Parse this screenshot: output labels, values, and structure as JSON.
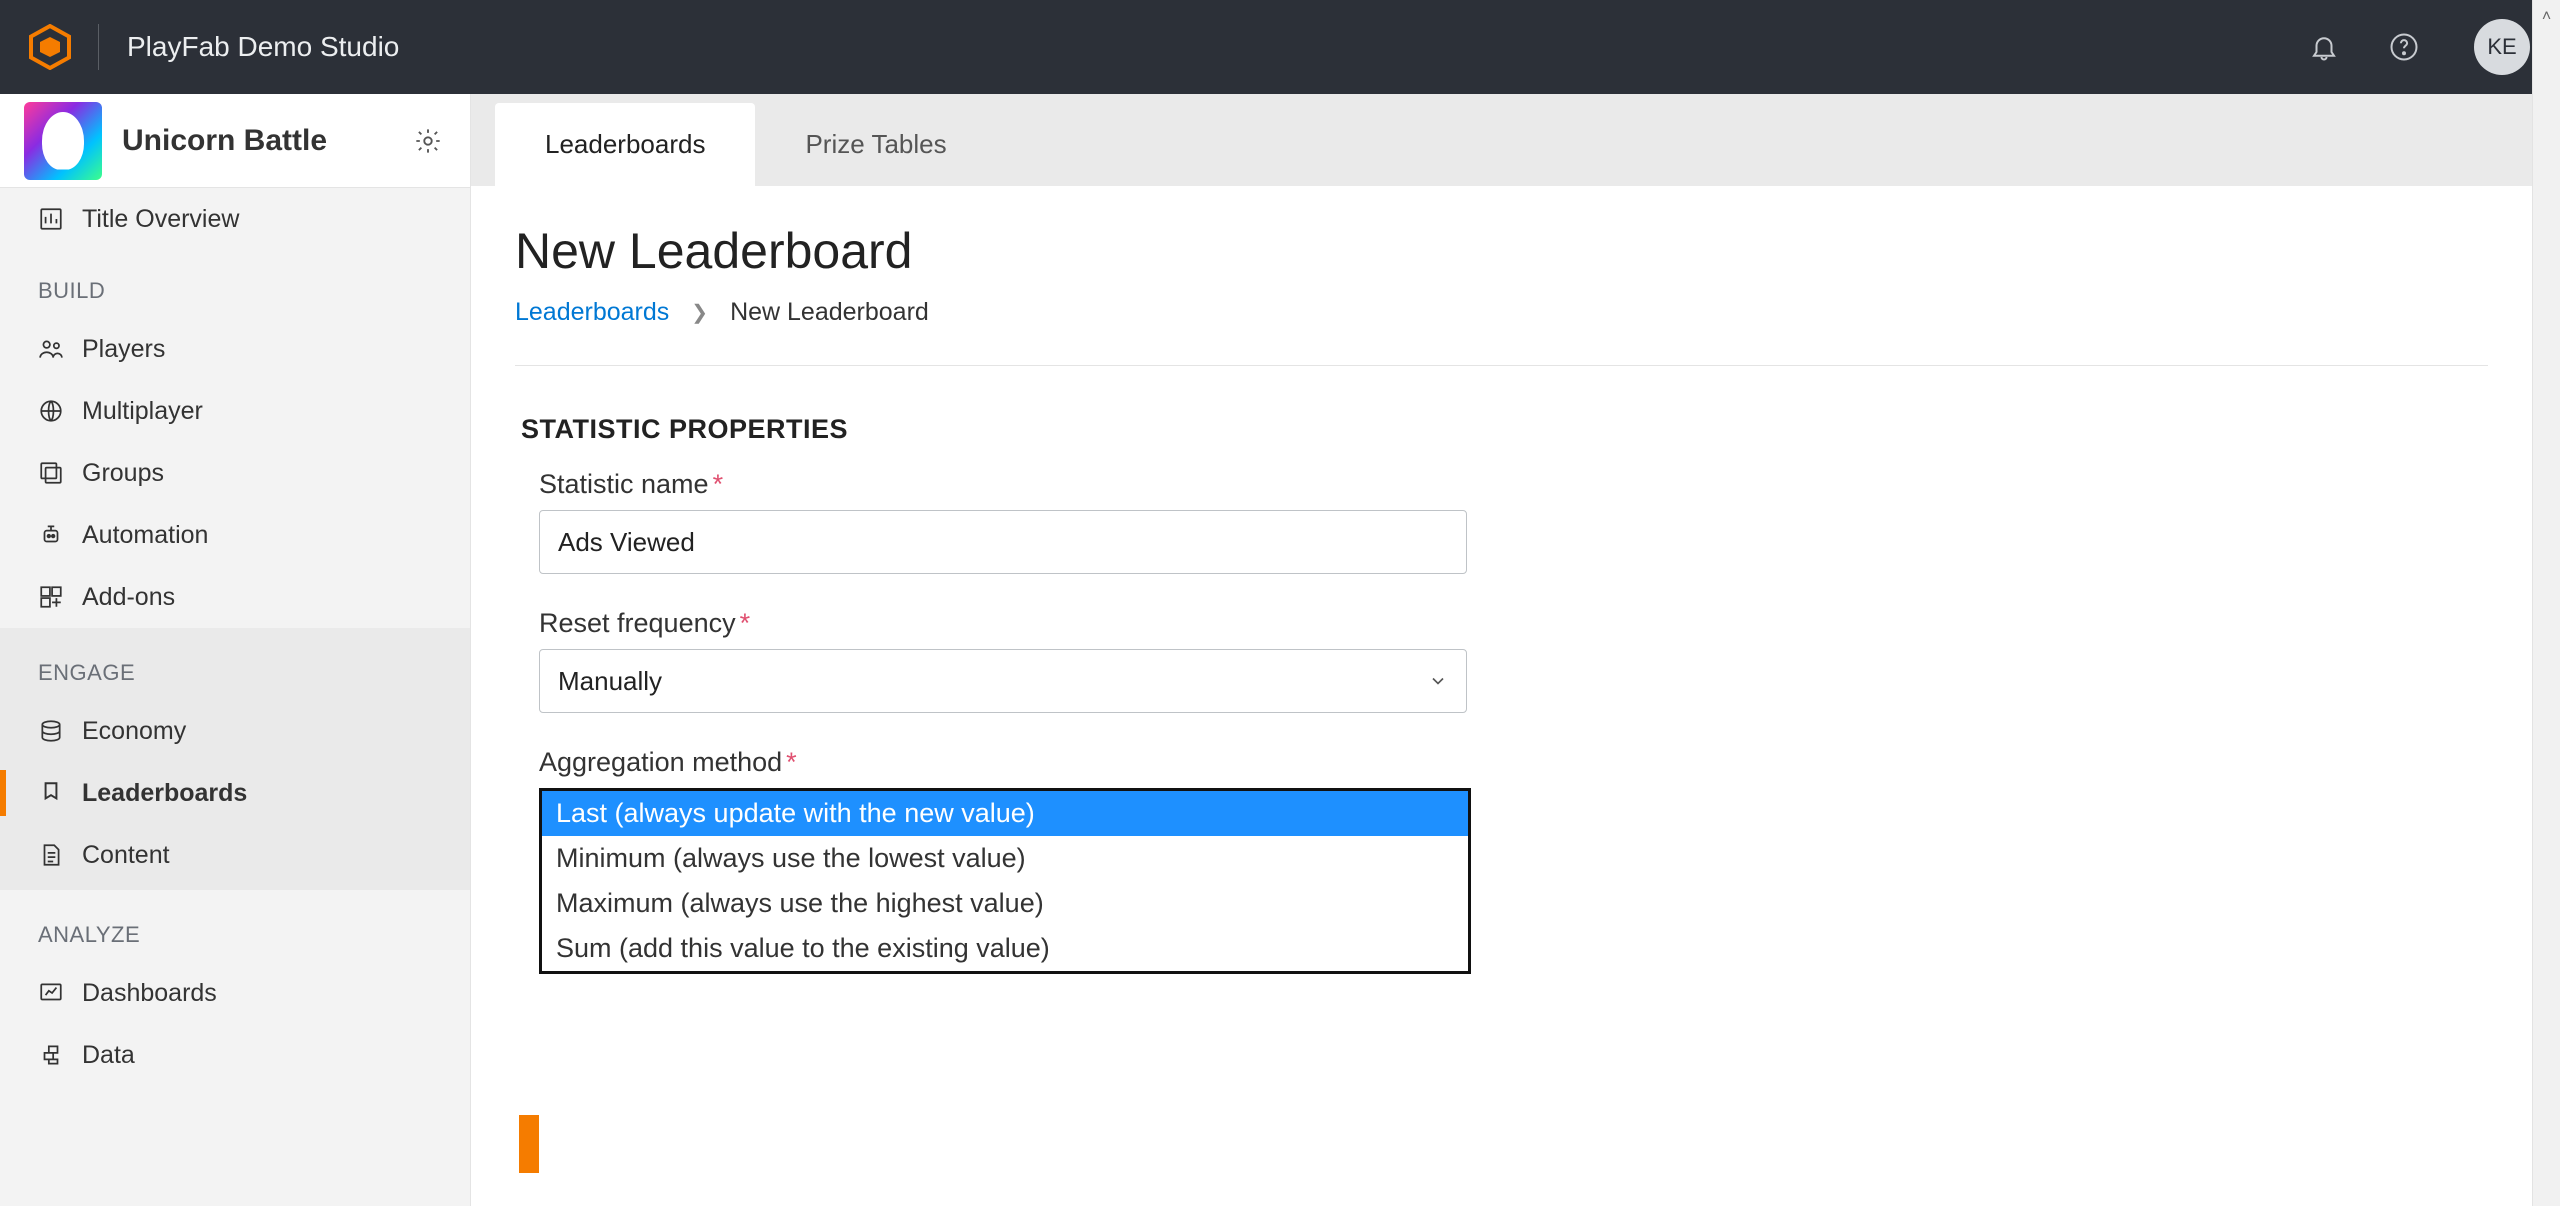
{
  "header": {
    "studio_name": "PlayFab Demo Studio",
    "avatar_initials": "KE"
  },
  "sidebar": {
    "title_name": "Unicorn Battle",
    "overview": "Title Overview",
    "sections": {
      "build": {
        "label": "BUILD",
        "items": [
          "Players",
          "Multiplayer",
          "Groups",
          "Automation",
          "Add-ons"
        ]
      },
      "engage": {
        "label": "ENGAGE",
        "items": [
          "Economy",
          "Leaderboards",
          "Content"
        ]
      },
      "analyze": {
        "label": "ANALYZE",
        "items": [
          "Dashboards",
          "Data"
        ]
      }
    }
  },
  "tabs": {
    "leaderboards": "Leaderboards",
    "prize_tables": "Prize Tables"
  },
  "page": {
    "title": "New Leaderboard",
    "breadcrumb_root": "Leaderboards",
    "breadcrumb_current": "New Leaderboard",
    "section_heading": "STATISTIC PROPERTIES",
    "fields": {
      "stat_name_label": "Statistic name",
      "stat_name_value": "Ads Viewed",
      "reset_label": "Reset frequency",
      "reset_value": "Manually",
      "agg_label": "Aggregation method",
      "agg_options": [
        "Last (always update with the new value)",
        "Minimum (always use the lowest value)",
        "Maximum (always use the highest value)",
        "Sum (add this value to the existing value)"
      ]
    }
  }
}
